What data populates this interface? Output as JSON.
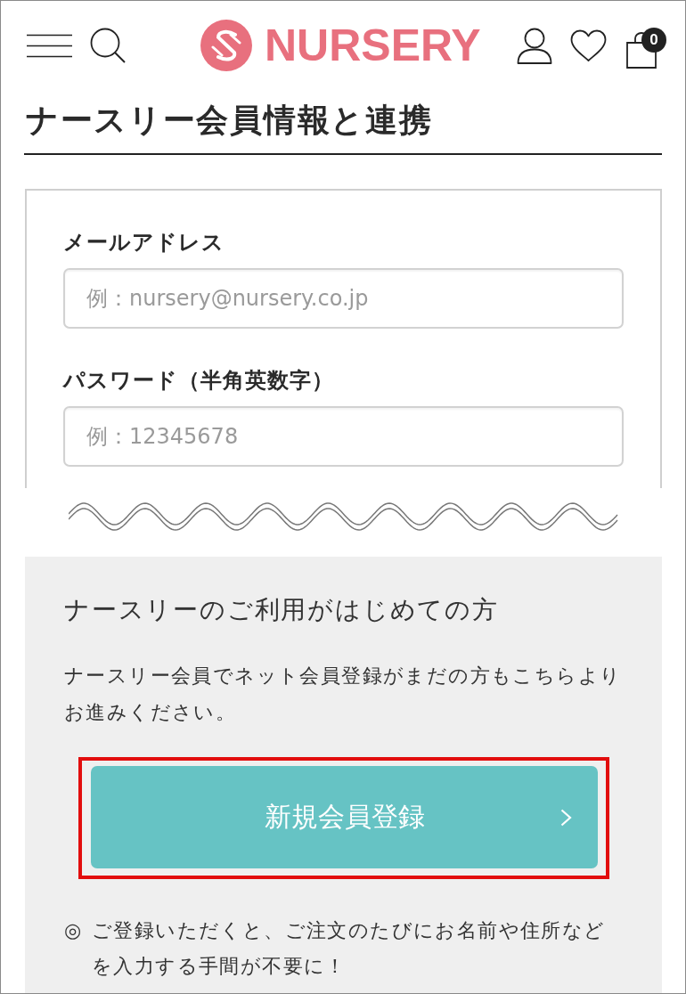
{
  "header": {
    "logo_text": "NURSERY",
    "cart_count": "0"
  },
  "page_title": "ナースリー会員情報と連携",
  "login_form": {
    "fields": [
      {
        "label": "メールアドレス",
        "placeholder": "例：nursery@nursery.co.jp"
      },
      {
        "label": "パスワード（半角英数字）",
        "placeholder": "例：12345678"
      }
    ]
  },
  "new_member": {
    "heading": "ナースリーのご利用がはじめての方",
    "description": "ナースリー会員でネット会員登録がまだの方もこちらよりお進みください。",
    "register_button": {
      "label": "新規会員登録",
      "highlighted": true
    },
    "note": {
      "bullet": "◎",
      "text": "ご登録いただくと、ご注文のたびにお名前や住所などを入力する手間が不要に！"
    }
  }
}
